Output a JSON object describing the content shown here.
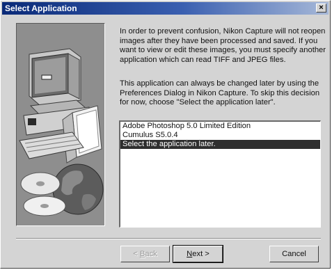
{
  "window": {
    "title": "Select Application",
    "close_glyph": "×"
  },
  "illustration": {
    "icons": [
      "computer-icon",
      "folder-icon",
      "keyboard-icon",
      "cd-disc-icon",
      "globe-icon"
    ]
  },
  "message": {
    "paragraph1": "In order to prevent confusion, Nikon Capture will not reopen images after they have been processed and saved.  If you want to view or edit these images, you must specify another application which can read TIFF and JPEG files.",
    "paragraph2": "This application can always be changed later by using the Preferences Dialog in Nikon Capture.  To skip this decision for now, choose \"Select the application later\"."
  },
  "app_list": {
    "items": [
      "Adobe Photoshop 5.0 Limited Edition",
      "Cumulus S5.0.4",
      "Select the application later."
    ],
    "selected_index": 2
  },
  "buttons": {
    "back_prefix": "< ",
    "back_mnemonic": "B",
    "back_rest": "ack",
    "next_mnemonic": "N",
    "next_rest": "ext >",
    "cancel": "Cancel"
  },
  "colors": {
    "titlebar_start": "#0a2a78",
    "titlebar_end": "#a6b8d8",
    "selection": "#2f2f2f",
    "dialog_face": "#d4d4d4"
  }
}
